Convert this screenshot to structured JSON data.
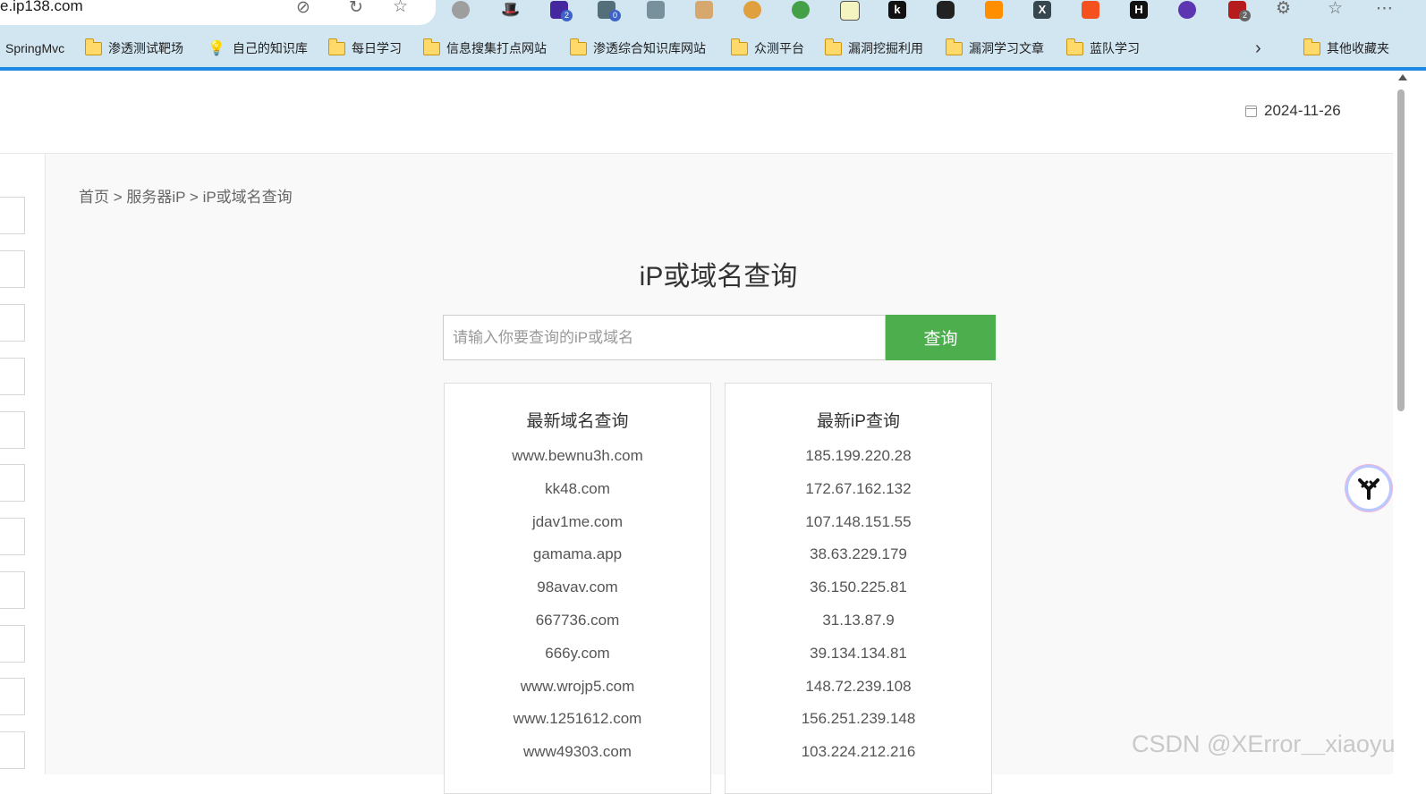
{
  "browser": {
    "url": "e.ip138.com",
    "extension_badges": [
      "2",
      "0",
      "2"
    ],
    "bookmarks": [
      {
        "label": "SpringMvc",
        "icon": "none"
      },
      {
        "label": "渗透测试靶场",
        "icon": "folder-icon"
      },
      {
        "label": "自己的知识库",
        "icon": "bulb-icon"
      },
      {
        "label": "每日学习",
        "icon": "folder-icon"
      },
      {
        "label": "信息搜集打点网站",
        "icon": "folder-icon"
      },
      {
        "label": "渗透综合知识库网站",
        "icon": "folder-icon"
      },
      {
        "label": "众测平台",
        "icon": "folder-icon"
      },
      {
        "label": "漏洞挖掘利用",
        "icon": "folder-icon"
      },
      {
        "label": "漏洞学习文章",
        "icon": "folder-icon"
      },
      {
        "label": "蓝队学习",
        "icon": "folder-icon"
      }
    ],
    "other_bookmarks": "其他收藏夹"
  },
  "header": {
    "date": "2024-11-26"
  },
  "breadcrumb": {
    "home": "首页",
    "sep": " > ",
    "section": "服务器iP",
    "current": "iP或域名查询"
  },
  "main": {
    "title": "iP或域名查询",
    "search_placeholder": "请输入你要查询的iP或域名",
    "search_value": "",
    "search_button": "查询"
  },
  "latest_domains": {
    "title": "最新域名查询",
    "items": [
      "www.bewnu3h.com",
      "kk48.com",
      "jdav1me.com",
      "gamama.app",
      "98avav.com",
      "667736.com",
      "666y.com",
      "www.wrojp5.com",
      "www.1251612.com",
      "www49303.com"
    ]
  },
  "latest_ips": {
    "title": "最新iP查询",
    "items": [
      "185.199.220.28",
      "172.67.162.132",
      "107.148.151.55",
      "38.63.229.179",
      "36.150.225.81",
      "31.13.87.9",
      "39.134.134.81",
      "148.72.239.108",
      "156.251.239.148",
      "103.224.212.216"
    ]
  },
  "watermark": "CSDN @XError＿xiaoyu",
  "colors": {
    "accent_blue": "#1e88e5",
    "search_button": "#4cae4c",
    "browser_bar": "#d2e6f1"
  }
}
